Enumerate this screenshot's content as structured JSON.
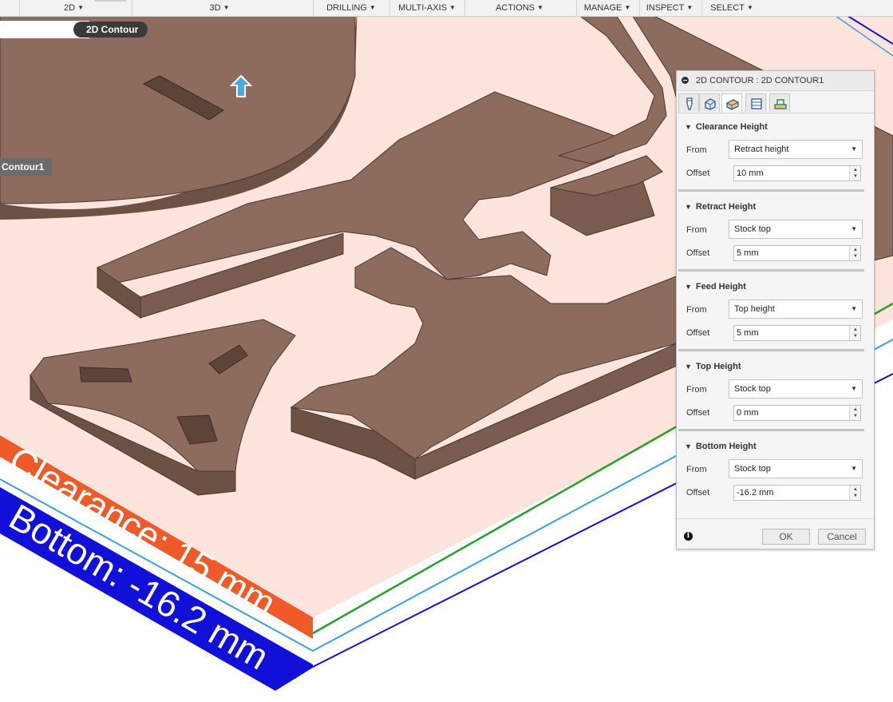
{
  "toolbar": {
    "items": [
      {
        "label": "2D"
      },
      {
        "label": "3D"
      },
      {
        "label": "DRILLING"
      },
      {
        "label": "MULTI-AXIS"
      },
      {
        "label": "ACTIONS"
      },
      {
        "label": "MANAGE"
      },
      {
        "label": "INSPECT"
      },
      {
        "label": "SELECT"
      }
    ]
  },
  "viewport": {
    "operation_tag": "2D Contour",
    "operation_tag_secondary": "Contour1",
    "clearance_label": "Clearance: 15 mm",
    "bottom_label": "Bottom: -16.2 mm",
    "colors": {
      "stock_plane": "#fde4dd",
      "part": "#8d6c5e",
      "clearance_band": "#f05a28",
      "bottom_band": "#1010d8",
      "feed_line": "#22a22a",
      "top_line": "#36a3e0"
    }
  },
  "dialog": {
    "title": "2D CONTOUR : 2D CONTOUR1",
    "tabs": [
      {
        "icon": "tool-tab-icon"
      },
      {
        "icon": "geometry-tab-icon"
      },
      {
        "icon": "heights-tab-icon"
      },
      {
        "icon": "passes-tab-icon"
      },
      {
        "icon": "linking-tab-icon"
      }
    ],
    "from_label": "From",
    "offset_label": "Offset",
    "sections": [
      {
        "title": "Clearance Height",
        "from": "Retract height",
        "offset": "10 mm"
      },
      {
        "title": "Retract Height",
        "from": "Stock top",
        "offset": "5 mm"
      },
      {
        "title": "Feed Height",
        "from": "Top height",
        "offset": "5 mm"
      },
      {
        "title": "Top Height",
        "from": "Stock top",
        "offset": "0 mm"
      },
      {
        "title": "Bottom Height",
        "from": "Stock top",
        "offset": "-16.2 mm"
      }
    ],
    "ok_label": "OK",
    "cancel_label": "Cancel"
  }
}
